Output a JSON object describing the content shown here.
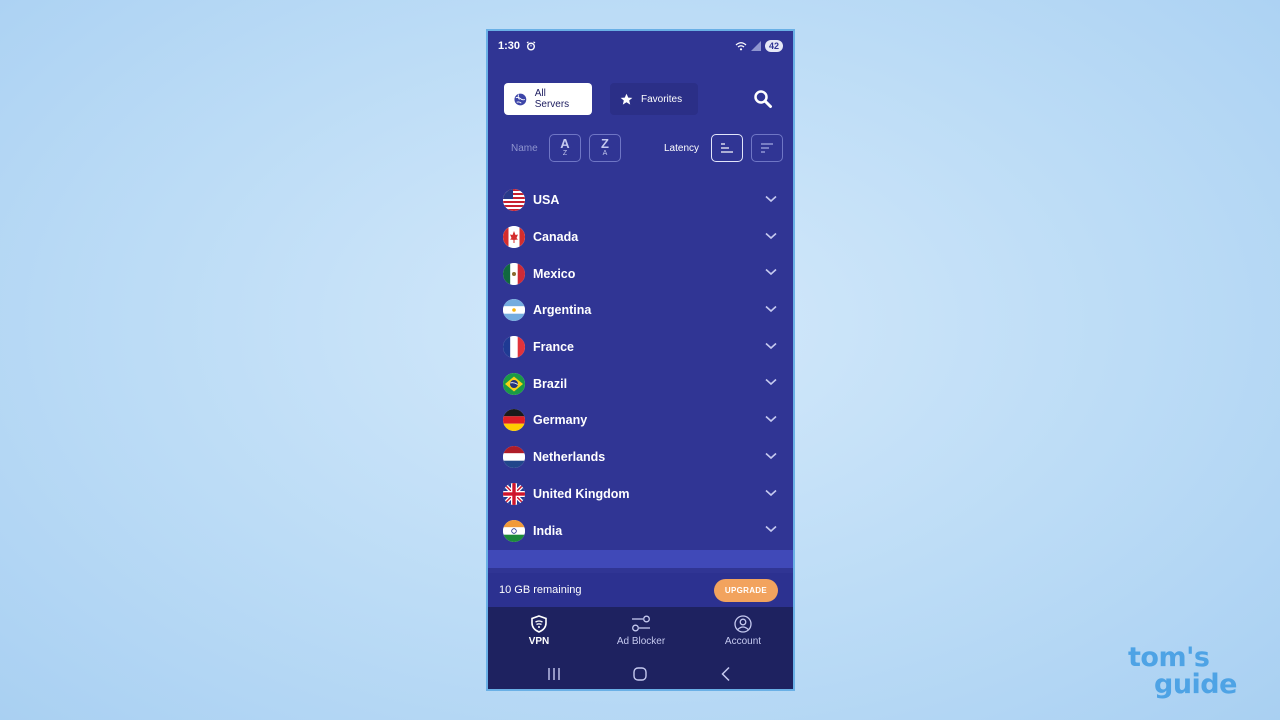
{
  "status": {
    "time": "1:30",
    "battery": "42"
  },
  "tabs": {
    "all_servers": "All Servers",
    "favorites": "Favorites"
  },
  "sort": {
    "name_label": "Name",
    "latency_label": "Latency",
    "az": {
      "big": "A",
      "small": "Z"
    },
    "za": {
      "big": "Z",
      "small": "A"
    }
  },
  "countries": [
    {
      "name": "USA",
      "flag": "us"
    },
    {
      "name": "Canada",
      "flag": "ca"
    },
    {
      "name": "Mexico",
      "flag": "mx"
    },
    {
      "name": "Argentina",
      "flag": "ar"
    },
    {
      "name": "France",
      "flag": "fr"
    },
    {
      "name": "Brazil",
      "flag": "br"
    },
    {
      "name": "Germany",
      "flag": "de"
    },
    {
      "name": "Netherlands",
      "flag": "nl"
    },
    {
      "name": "United Kingdom",
      "flag": "gb"
    },
    {
      "name": "India",
      "flag": "in"
    }
  ],
  "quota": {
    "remaining": "10 GB remaining",
    "upgrade_label": "UPGRADE"
  },
  "nav": {
    "vpn": "VPN",
    "ad_blocker": "Ad Blocker",
    "account": "Account"
  },
  "brand": {
    "line1": "tom's",
    "line2": "guide"
  },
  "colors": {
    "app_bg": "#303594",
    "nav_bg": "#1e2260",
    "accent": "#f2a35e",
    "page_bg": "#bcdcf6"
  }
}
